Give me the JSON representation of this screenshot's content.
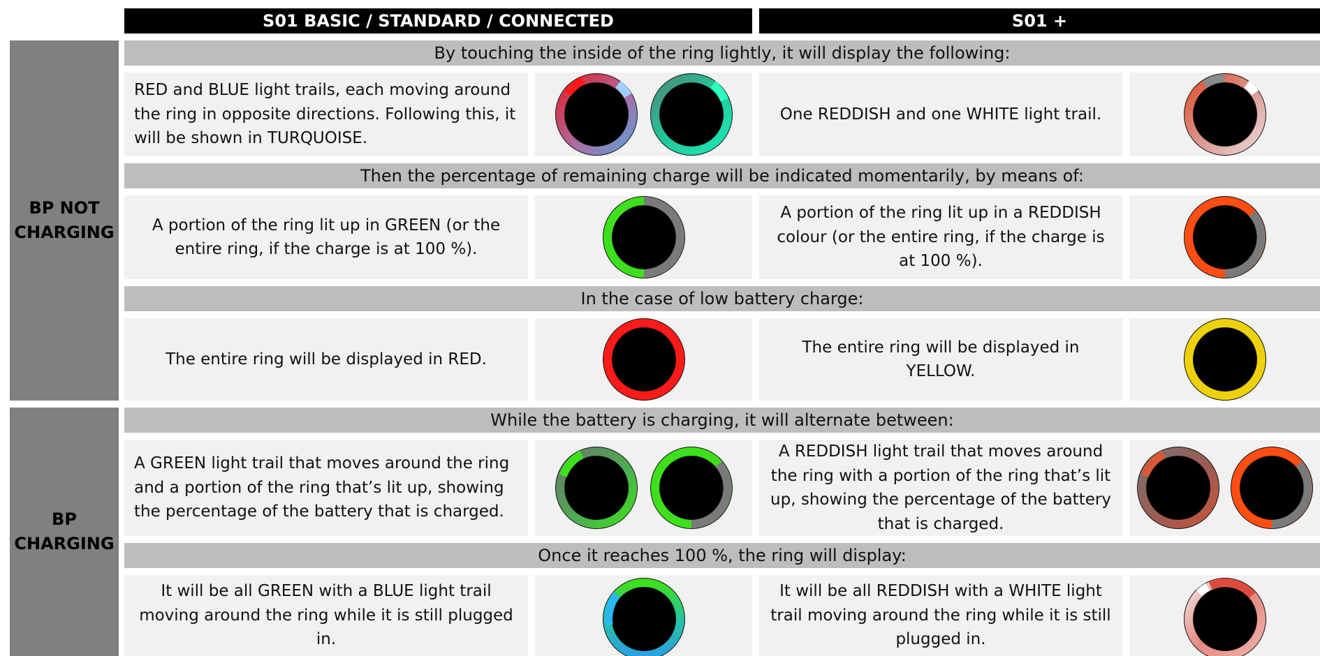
{
  "headers": {
    "col_basic": "S01 BASIC / STANDARD / CONNECTED",
    "col_plus": "S01 +"
  },
  "sections": {
    "not_charging": "BP NOT\nCHARGING",
    "charging": "BP\nCHARGING"
  },
  "bands": {
    "touch": "By touching the inside of the ring lightly, it will display the following:",
    "percentage": "Then the percentage of remaining charge will be indicated momentarily, by means of:",
    "low": "In the case of low battery charge:",
    "charging": "While the battery is charging, it will alternate between:",
    "full": "Once it reaches 100 %, the ring will display:"
  },
  "rows": {
    "touch": {
      "basic_text": "RED and BLUE light trails, each moving around the ring in opposite directions. Following this, it will be shown in TURQUOISE.",
      "plus_text": "One REDDISH and one WHITE light trail."
    },
    "percentage": {
      "basic_text": "A portion of the ring lit up in GREEN (or the entire ring, if the charge is at 100 %).",
      "plus_text": "A portion of the ring lit up in a REDDISH colour (or the entire ring, if the charge is at 100 %)."
    },
    "low": {
      "basic_text": "The entire ring will be displayed in RED.",
      "plus_text": "The entire ring will be displayed in YELLOW."
    },
    "charging": {
      "basic_text": "A GREEN light trail that moves around the ring and a portion of the ring that’s lit up, showing the percentage of the battery that is charged.",
      "plus_text": "A REDDISH light trail that moves around the ring with a portion of the ring that’s lit up, showing the percentage of the battery that is charged."
    },
    "full": {
      "basic_text": "It will be all GREEN with a BLUE light trail moving around the ring while it is still plugged in.",
      "plus_text": "It will be all REDDISH with a WHITE light trail moving around the ring while it is still plugged in."
    }
  },
  "ring_icons": {
    "touch_basic_1": "ring-red-blue-trails-icon",
    "touch_basic_2": "ring-turquoise-icon",
    "touch_plus": "ring-reddish-white-trail-icon",
    "percentage_basic": "ring-green-portion-icon",
    "percentage_plus": "ring-reddish-portion-icon",
    "low_basic": "ring-red-full-icon",
    "low_plus": "ring-yellow-full-icon",
    "charging_basic_1": "ring-green-trail-icon",
    "charging_basic_2": "ring-green-portion-icon",
    "charging_plus_1": "ring-reddish-trail-icon",
    "charging_plus_2": "ring-reddish-portion-icon",
    "full_basic": "ring-green-blue-trail-icon",
    "full_plus": "ring-reddish-white-trail-icon"
  },
  "colors": {
    "header_bg": "#000000",
    "section_bg": "#808080",
    "band_bg": "#bdbdbd",
    "cell_bg": "#f1f1f1",
    "ring_red": "#ff1a1a",
    "ring_blue": "#5aa0d8",
    "ring_turquoise": "#1ee6b4",
    "ring_green": "#3ee01c",
    "ring_reddish": "#ff4d14",
    "ring_yellow": "#ecd10c",
    "ring_gray": "#7a7a7a"
  }
}
